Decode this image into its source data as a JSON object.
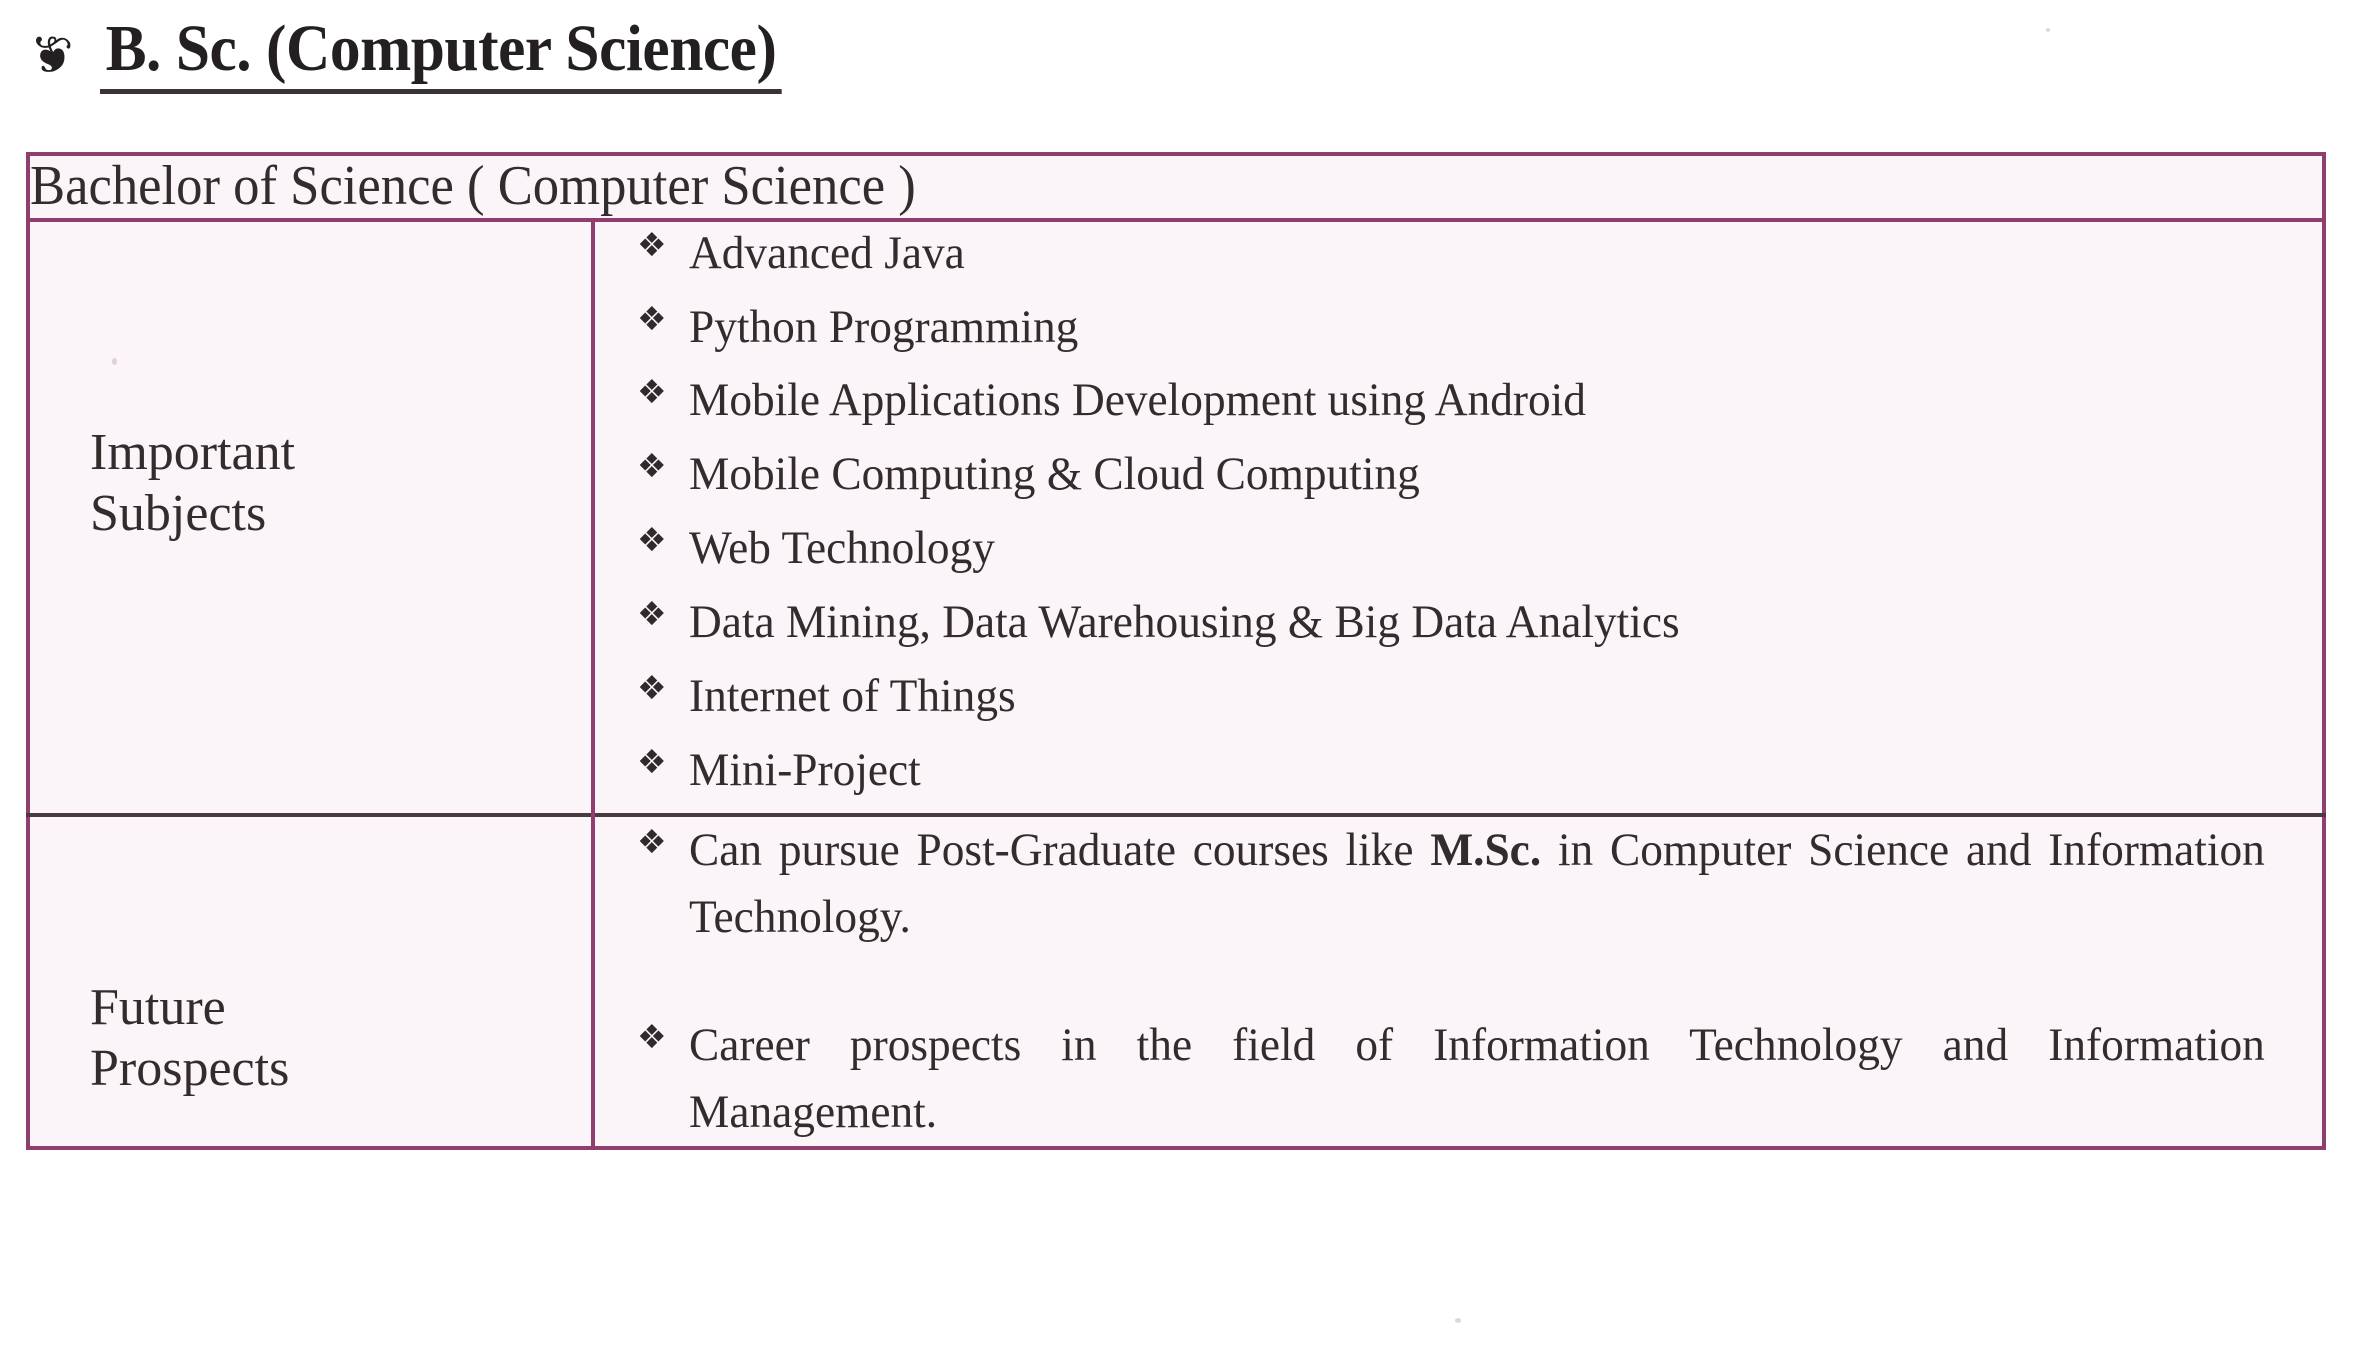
{
  "heading": {
    "ornament_icon": "floral-heart-ornament",
    "ornament_glyph": "⁊̵",
    "title": "B. Sc. (Computer Science)"
  },
  "table": {
    "header": "Bachelor of Science ( Computer Science )",
    "border_color": "#8e3f6e",
    "cell_background": "#fbf4f8",
    "text_color": "#332c2d",
    "bullet_glyph": "❖",
    "bullet_icon": "diamond-cluster-bullet-icon",
    "rows": [
      {
        "label_line1": "Important",
        "label_line2": "Subjects",
        "items": [
          "Advanced Java",
          "Python Programming",
          "Mobile Applications Development using Android",
          "Mobile Computing & Cloud Computing",
          "Web Technology",
          "Data Mining, Data Warehousing & Big Data Analytics",
          "Internet of Things",
          "Mini-Project"
        ]
      },
      {
        "label_line1": "Future",
        "label_line2": "Prospects",
        "items": [
          {
            "before_bold": "Can pursue  Post-Graduate courses  like  ",
            "bold": "M.Sc.",
            "after_bold": "  in  Computer Science and Information Technology."
          },
          {
            "before_bold": "Career  prospects in  the field of  Information  Technology and Information Management.",
            "bold": "",
            "after_bold": ""
          }
        ]
      }
    ]
  }
}
